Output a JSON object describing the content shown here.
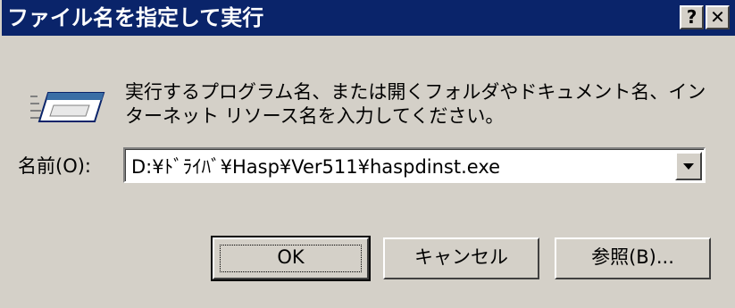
{
  "window": {
    "title": "ファイル名を指定して実行",
    "help_label": "?",
    "close_label": "✕"
  },
  "description": "実行するプログラム名、または開くフォルダやドキュメント名、インターネット リソース名を入力してください。",
  "name_field": {
    "label": "名前(O):",
    "value": "D:¥ﾄﾞﾗｲﾊﾞ¥Hasp¥Ver511¥haspdinst.exe"
  },
  "buttons": {
    "ok": "OK",
    "cancel": "キャンセル",
    "browse": "参照(B)..."
  },
  "colors": {
    "titlebar": "#0a246a",
    "face": "#d4d0c8"
  },
  "icons": [
    "run-icon",
    "chevron-down-icon"
  ]
}
